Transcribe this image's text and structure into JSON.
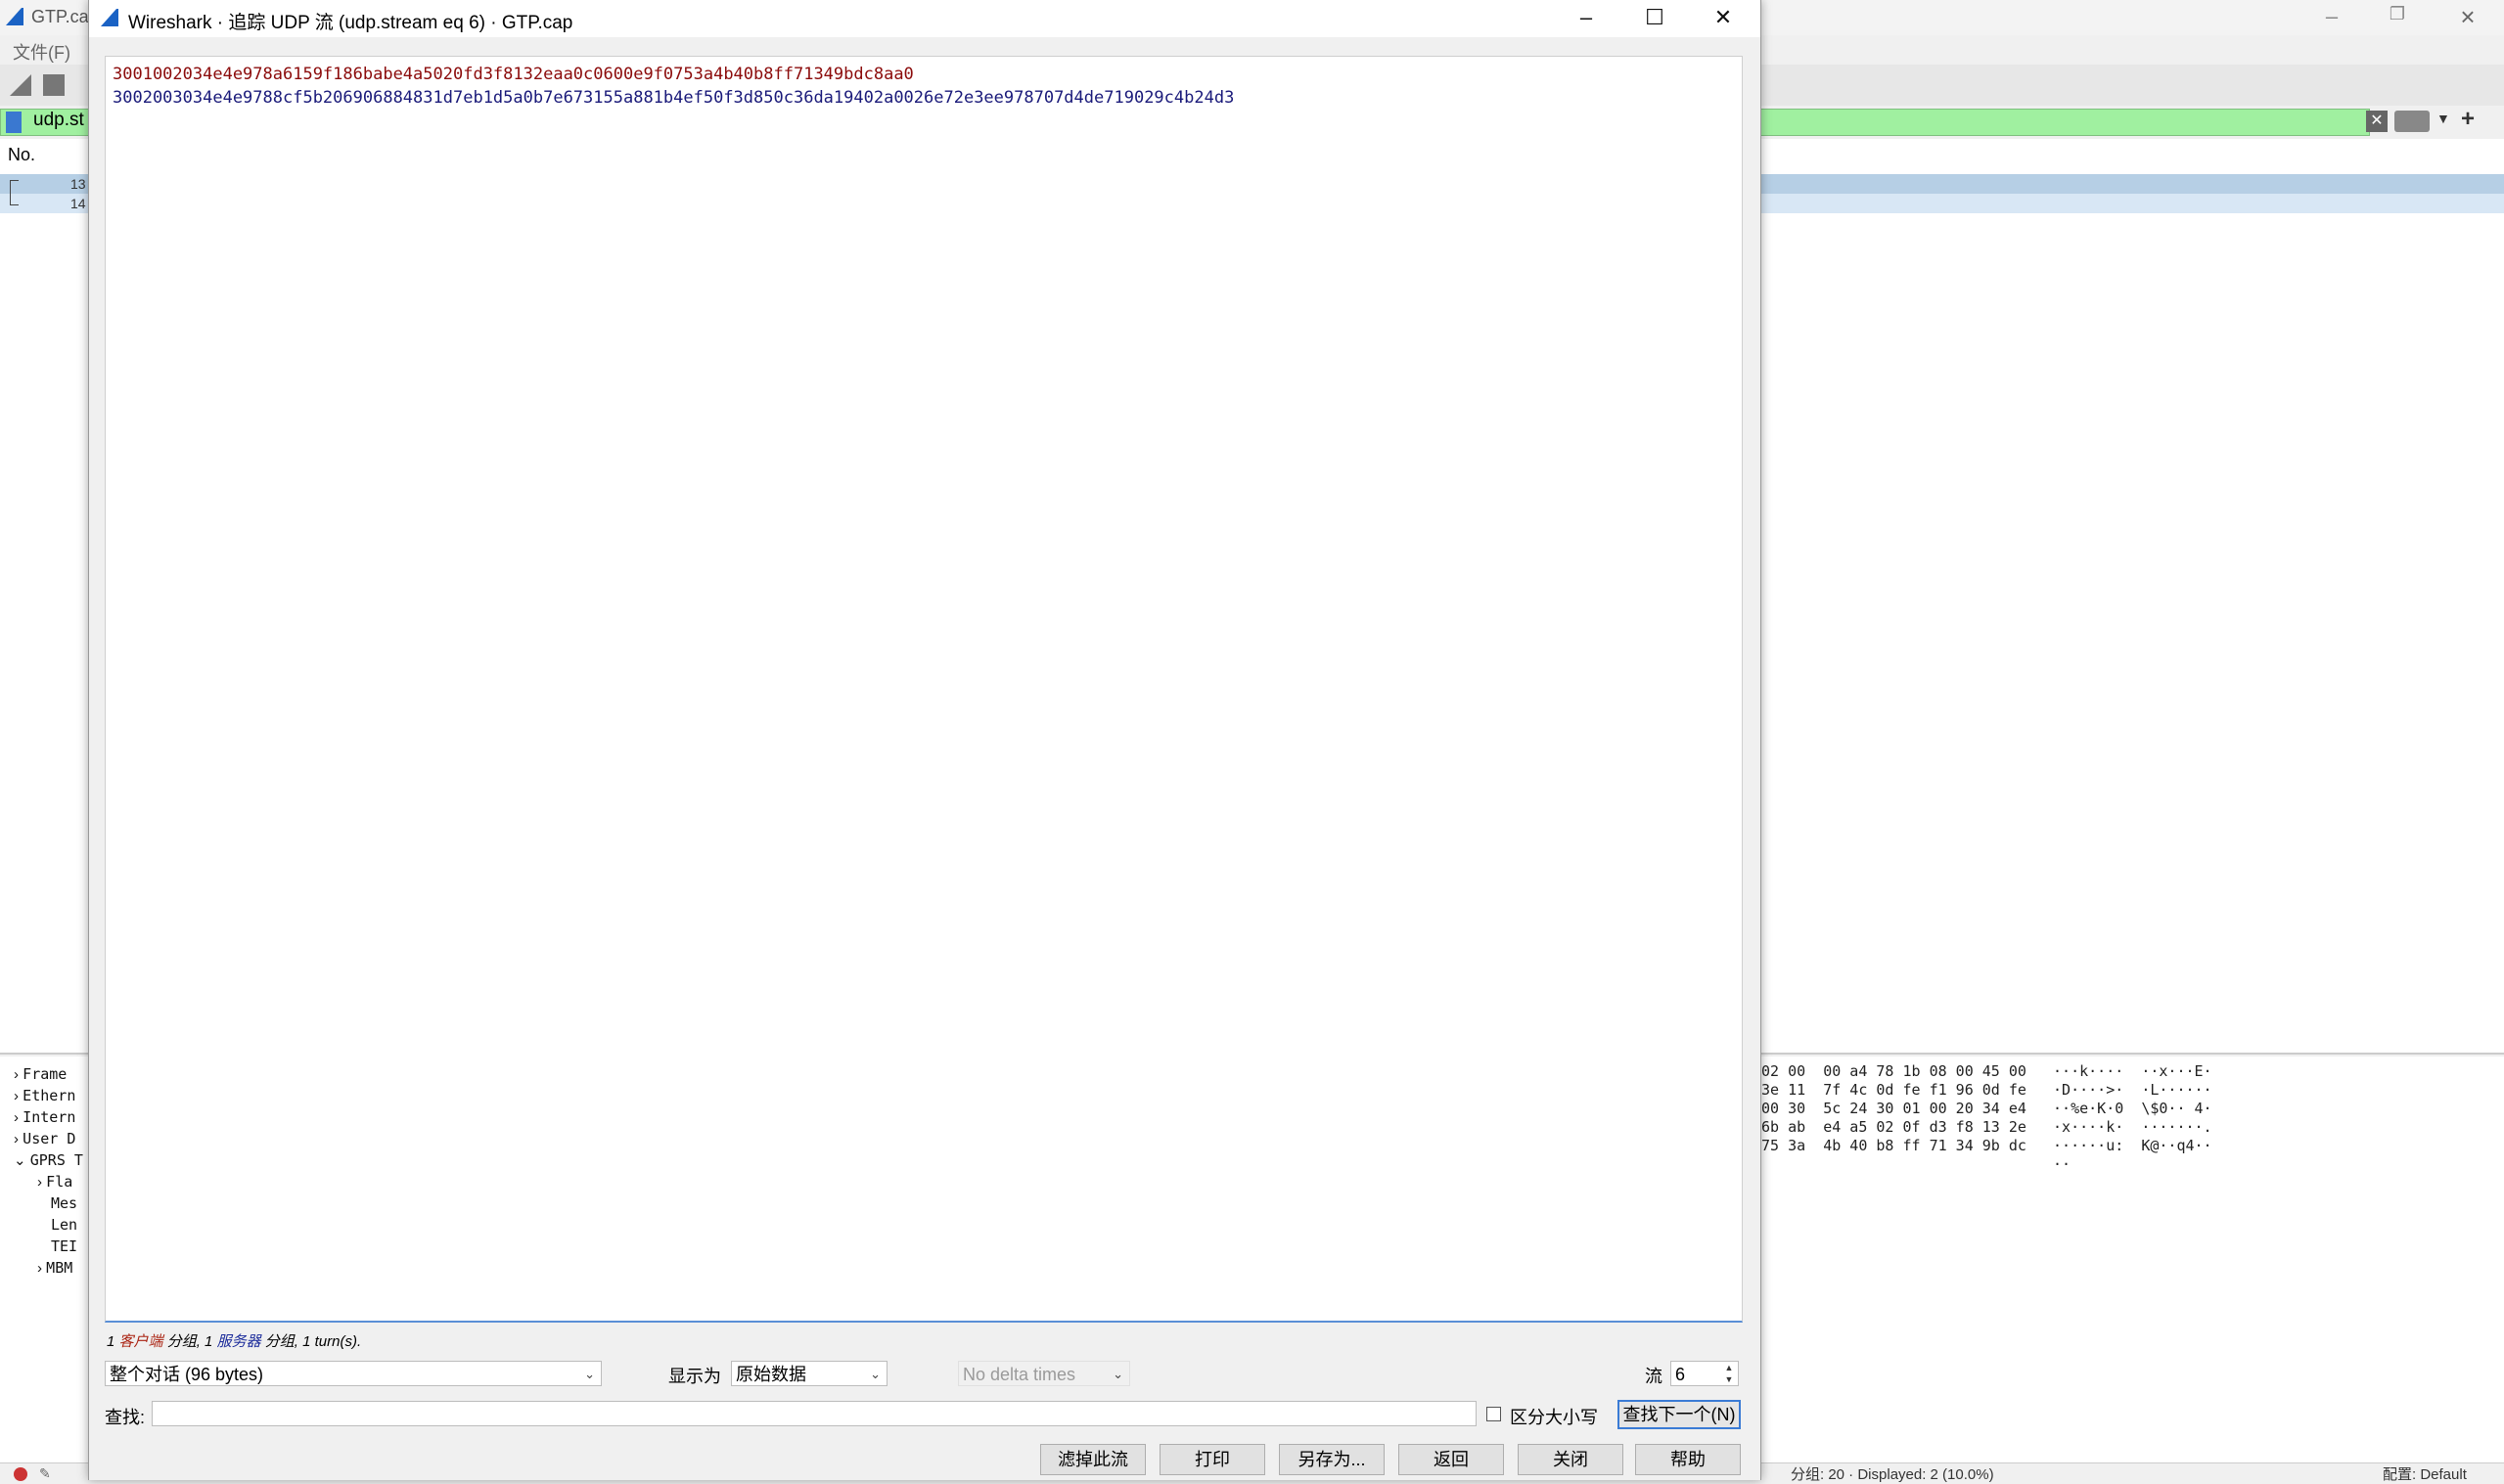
{
  "main_window": {
    "title": "GTP.cap",
    "menu_file": "文件(F)",
    "filter_text": "udp.st",
    "list_header_no": "No.",
    "rows": [
      {
        "no": "13"
      },
      {
        "no": "14"
      }
    ],
    "tree": [
      {
        "label": "Frame",
        "expander": "›"
      },
      {
        "label": "Ethern",
        "expander": "›"
      },
      {
        "label": "Intern",
        "expander": "›"
      },
      {
        "label": "User D",
        "expander": "›"
      },
      {
        "label": "GPRS T",
        "expander": "⌄"
      },
      {
        "label": "Fla",
        "expander": "›"
      },
      {
        "label": "Mes",
        "expander": ""
      },
      {
        "label": "Len",
        "expander": ""
      },
      {
        "label": "TEI",
        "expander": ""
      },
      {
        "label": "MBM",
        "expander": "›"
      }
    ],
    "hex_lines": [
      "02 00  00 a4 78 1b 08 00 45 00   ···k····  ··x···E·",
      "3e 11  7f 4c 0d fe f1 96 0d fe   ·D····>·  ·L······",
      "00 30  5c 24 30 01 00 20 34 e4   ··%e·K·0  \\$0·· 4·",
      "6b ab  e4 a5 02 0f d3 f8 13 2e   ·x····k·  ·······.",
      "75 3a  4b 40 b8 ff 71 34 9b dc   ······u:  K@··q4··",
      "                                 ··"
    ],
    "status_text": "分组: 20 · Displayed: 2 (10.0%)",
    "status_profile": "配置: Default"
  },
  "dialog": {
    "title": "Wireshark · 追踪 UDP 流 (udp.stream eq 6) · GTP.cap",
    "stream_lines": [
      "3001002034e4e978a6159f186babe4a5020fd3f8132eaa0c0600e9f0753a4b40b8ff71349bdc8aa0",
      "3002003034e4e9788cf5b206906884831d7eb1d5a0b7e673155a881b4ef50f3d850c36da19402a0026e72e3ee978707d4de719029c4b24d3"
    ],
    "summary": {
      "client_count": "1",
      "client_label": "客户端",
      "client_suffix": "分组,",
      "server_count": "1",
      "server_label": "服务器",
      "server_suffix": "分组,",
      "turns": "1 turn(s)."
    },
    "conversation_select": "整个对话 (96 bytes)",
    "show_as_label": "显示为",
    "show_as_select": "原始数据",
    "delta_select": "No delta times",
    "stream_label": "流",
    "stream_number": "6",
    "find_label": "查找:",
    "find_value": "",
    "case_sensitive_label": "区分大小写",
    "find_next_label": "查找下一个(N)",
    "buttons": {
      "filter_out": "滤掉此流",
      "print": "打印",
      "save_as": "另存为...",
      "back": "返回",
      "close": "关闭",
      "help": "帮助"
    }
  },
  "colors": {
    "client_text": "#8b0b0b",
    "server_text": "#1a1a7a",
    "filter_valid_bg": "#a0f0a0",
    "selection_row": "#b6cfe5"
  }
}
